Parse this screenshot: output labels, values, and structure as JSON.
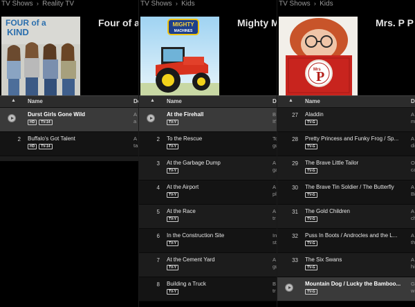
{
  "panels": [
    {
      "breadcrumb": [
        "TV Shows",
        "Reality TV"
      ],
      "show_title": "Four of a",
      "cover": {
        "title_line1": "FOUR of a",
        "title_line2": "KIND"
      },
      "header": {
        "sort": "▲",
        "name": "Name",
        "desc": "De"
      },
      "episodes": [
        {
          "num": "",
          "play": true,
          "selected": true,
          "name": "Durst Girls Gone Wild",
          "badges": [
            "HD",
            "TV-14"
          ],
          "desc": [
            "A",
            "a"
          ]
        },
        {
          "num": "2",
          "play": false,
          "selected": false,
          "name": "Buffalo's Got Talent",
          "badges": [
            "HD",
            "TV-14"
          ],
          "desc": [
            "A",
            "ta"
          ]
        }
      ]
    },
    {
      "breadcrumb": [
        "TV Shows",
        "Kids"
      ],
      "show_title": "Mighty M",
      "cover": {
        "title_line1": "MIGHTY",
        "title_line2": "MACHINES"
      },
      "header": {
        "sort": "▲",
        "name": "Name",
        "desc": "De"
      },
      "episodes": [
        {
          "num": "",
          "play": true,
          "selected": true,
          "name": "At the Firehall",
          "badges": [
            "TV-Y"
          ],
          "desc": [
            "B",
            "It'"
          ]
        },
        {
          "num": "2",
          "play": false,
          "selected": false,
          "name": "To the Rescue",
          "badges": [
            "TV-Y"
          ],
          "desc": [
            "To",
            "gu"
          ]
        },
        {
          "num": "3",
          "play": false,
          "selected": false,
          "name": "At the Garbage Dump",
          "badges": [
            "TV-Y"
          ],
          "desc": [
            "A",
            "ga"
          ]
        },
        {
          "num": "4",
          "play": false,
          "selected": false,
          "name": "At the Airport",
          "badges": [
            "TV-Y"
          ],
          "desc": [
            "A",
            "pl"
          ]
        },
        {
          "num": "5",
          "play": false,
          "selected": false,
          "name": "At the Race",
          "badges": [
            "TV-Y"
          ],
          "desc": [
            "A",
            "tr"
          ]
        },
        {
          "num": "6",
          "play": false,
          "selected": false,
          "name": "In the Construction Site",
          "badges": [
            "TV-Y"
          ],
          "desc": [
            "In",
            "st"
          ]
        },
        {
          "num": "7",
          "play": false,
          "selected": false,
          "name": "At the Cement Yard",
          "badges": [
            "TV-Y"
          ],
          "desc": [
            "A",
            "gu"
          ]
        },
        {
          "num": "8",
          "play": false,
          "selected": false,
          "name": "Building a Truck",
          "badges": [
            "TV-Y"
          ],
          "desc": [
            "B",
            "tr"
          ]
        }
      ]
    },
    {
      "breadcrumb": [
        "TV Shows",
        "Kids"
      ],
      "show_title": "Mrs. P P",
      "cover": {
        "title_line1": "Mrs",
        "title_line2": "P"
      },
      "header": {
        "sort": "▲",
        "name": "Name",
        "desc": "De"
      },
      "episodes": [
        {
          "num": "27",
          "play": false,
          "selected": false,
          "name": "Aladdin",
          "badges": [
            "TV-G"
          ],
          "desc": [
            "A",
            "m"
          ]
        },
        {
          "num": "28",
          "play": false,
          "selected": false,
          "name": "Pretty Princess and Funky Frog / Sp...",
          "badges": [
            "TV-G"
          ],
          "desc": [
            "A",
            "di"
          ]
        },
        {
          "num": "29",
          "play": false,
          "selected": false,
          "name": "The Brave Little Tailor",
          "badges": [
            "TV-G"
          ],
          "desc": [
            "O",
            "ca"
          ]
        },
        {
          "num": "30",
          "play": false,
          "selected": false,
          "name": "The Brave Tin Soldier / The Butterfly",
          "badges": [
            "TV-G"
          ],
          "desc": [
            "A",
            "Bi"
          ]
        },
        {
          "num": "31",
          "play": false,
          "selected": false,
          "name": "The Gold Children",
          "badges": [
            "TV-G"
          ],
          "desc": [
            "A",
            "ch"
          ]
        },
        {
          "num": "32",
          "play": false,
          "selected": false,
          "name": "Puss In Boots / Androcles and the L...",
          "badges": [
            "TV-G"
          ],
          "desc": [
            "A",
            "th"
          ]
        },
        {
          "num": "33",
          "play": false,
          "selected": false,
          "name": "The Six Swans",
          "badges": [
            "TV-G"
          ],
          "desc": [
            "A",
            "hi"
          ]
        },
        {
          "num": "",
          "play": true,
          "selected": true,
          "name": "Mountain Dog / Lucky the Bamboo...",
          "badges": [
            "TV-G"
          ],
          "desc": [
            "G",
            "w"
          ]
        }
      ]
    }
  ]
}
